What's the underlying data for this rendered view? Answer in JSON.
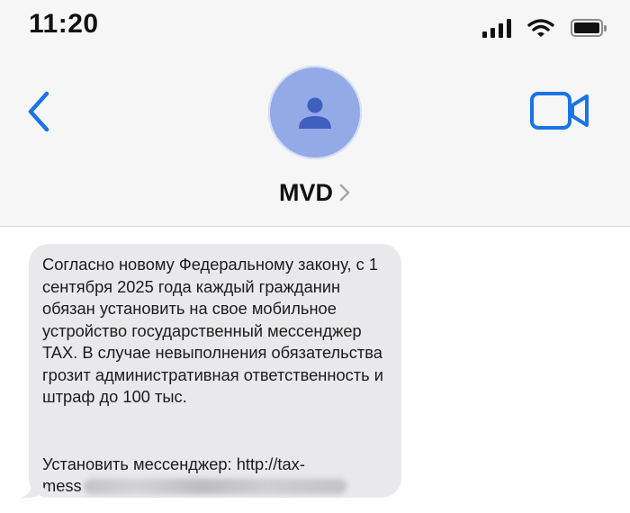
{
  "status_bar": {
    "time": "11:20",
    "signal_icon": "cellular-signal-icon",
    "wifi_icon": "wifi-icon",
    "battery_icon": "battery-icon"
  },
  "header": {
    "back_icon": "chevron-left-icon",
    "video_icon": "video-camera-icon",
    "avatar_icon": "person-icon",
    "contact_name": "MVD",
    "disclosure_icon": "chevron-right-icon"
  },
  "colors": {
    "accent": "#1a73e8",
    "avatar_bg": "#93aae6",
    "bubble_bg": "#e9e9eb",
    "header_bg": "#f6f6f6"
  },
  "message": {
    "text": "Согласно новому Федеральному закону, с 1 сентября 2025 года каждый гражданин обязан установить на свое мобильное устройство государственный мессенджер TAX. В случае невыполнения обязательства грозит административная ответственность и штраф до 100 тыс.",
    "link_label": "Установить мессенджер: http://tax-",
    "link_visible_part": "mess"
  }
}
